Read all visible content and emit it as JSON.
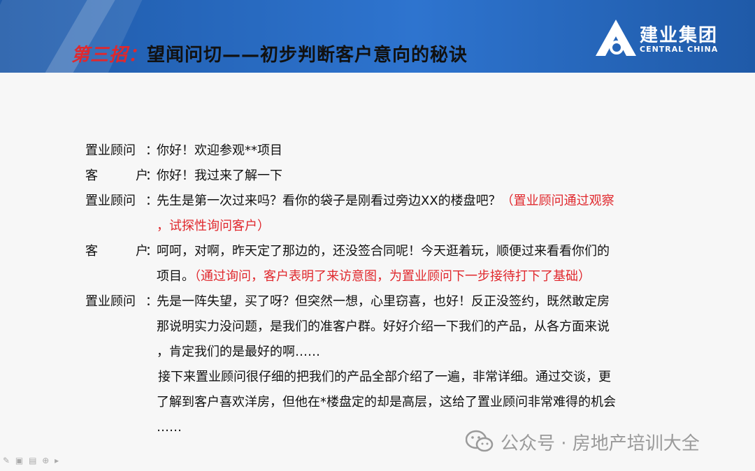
{
  "header": {
    "title_prefix": "第三招：",
    "title_main": "望闻问切——初步判断客户意向的秘诀",
    "logo_cn": "建业集团",
    "logo_en": "CENTRAL CHINA"
  },
  "dialogue": {
    "l1": {
      "speaker": "置业顾问",
      "text": "你好！欢迎参观**项目"
    },
    "l2": {
      "speaker_a": "客",
      "speaker_b": "户",
      "text": "你好！我过来了解一下"
    },
    "l3": {
      "speaker": "置业顾问",
      "text": "先生是第一次过来吗？看你的袋子是刚看过旁边XX的楼盘吧？",
      "note": "（置业顾问通过观察"
    },
    "l4": {
      "note": "，试探性询问客户）"
    },
    "l5": {
      "speaker_a": "客",
      "speaker_b": "户",
      "text": "呵呵，对啊，昨天定了那边的，还没签合同呢！今天逛着玩，顺便过来看看你们的"
    },
    "l6": {
      "text": "项目。",
      "note": "（通过询问，客户表明了来访意图，为置业顾问下一步接待打下了基础）"
    },
    "l7": {
      "speaker": "置业顾问",
      "text": "先是一阵失望，买了呀？但突然一想，心里窃喜，也好！反正没签约，既然敢定房"
    },
    "l8": {
      "text": "那说明实力没问题，是我们的准客户群。好好介绍一下我们的产品，从各方面来说"
    },
    "l9": {
      "text": "，肯定我们的是最好的啊……"
    },
    "l10": {
      "text": "接下来置业顾问很仔细的把我们的产品全部介绍了一遍，非常详细。通过交谈，更"
    },
    "l11": {
      "text": "了解到客户喜欢洋房，但他在*楼盘定的却是高层，这给了置业顾问非常难得的机会"
    },
    "l12": {
      "text": "……"
    }
  },
  "colon": "：",
  "watermark": "公众号 · 房地产培训大全"
}
